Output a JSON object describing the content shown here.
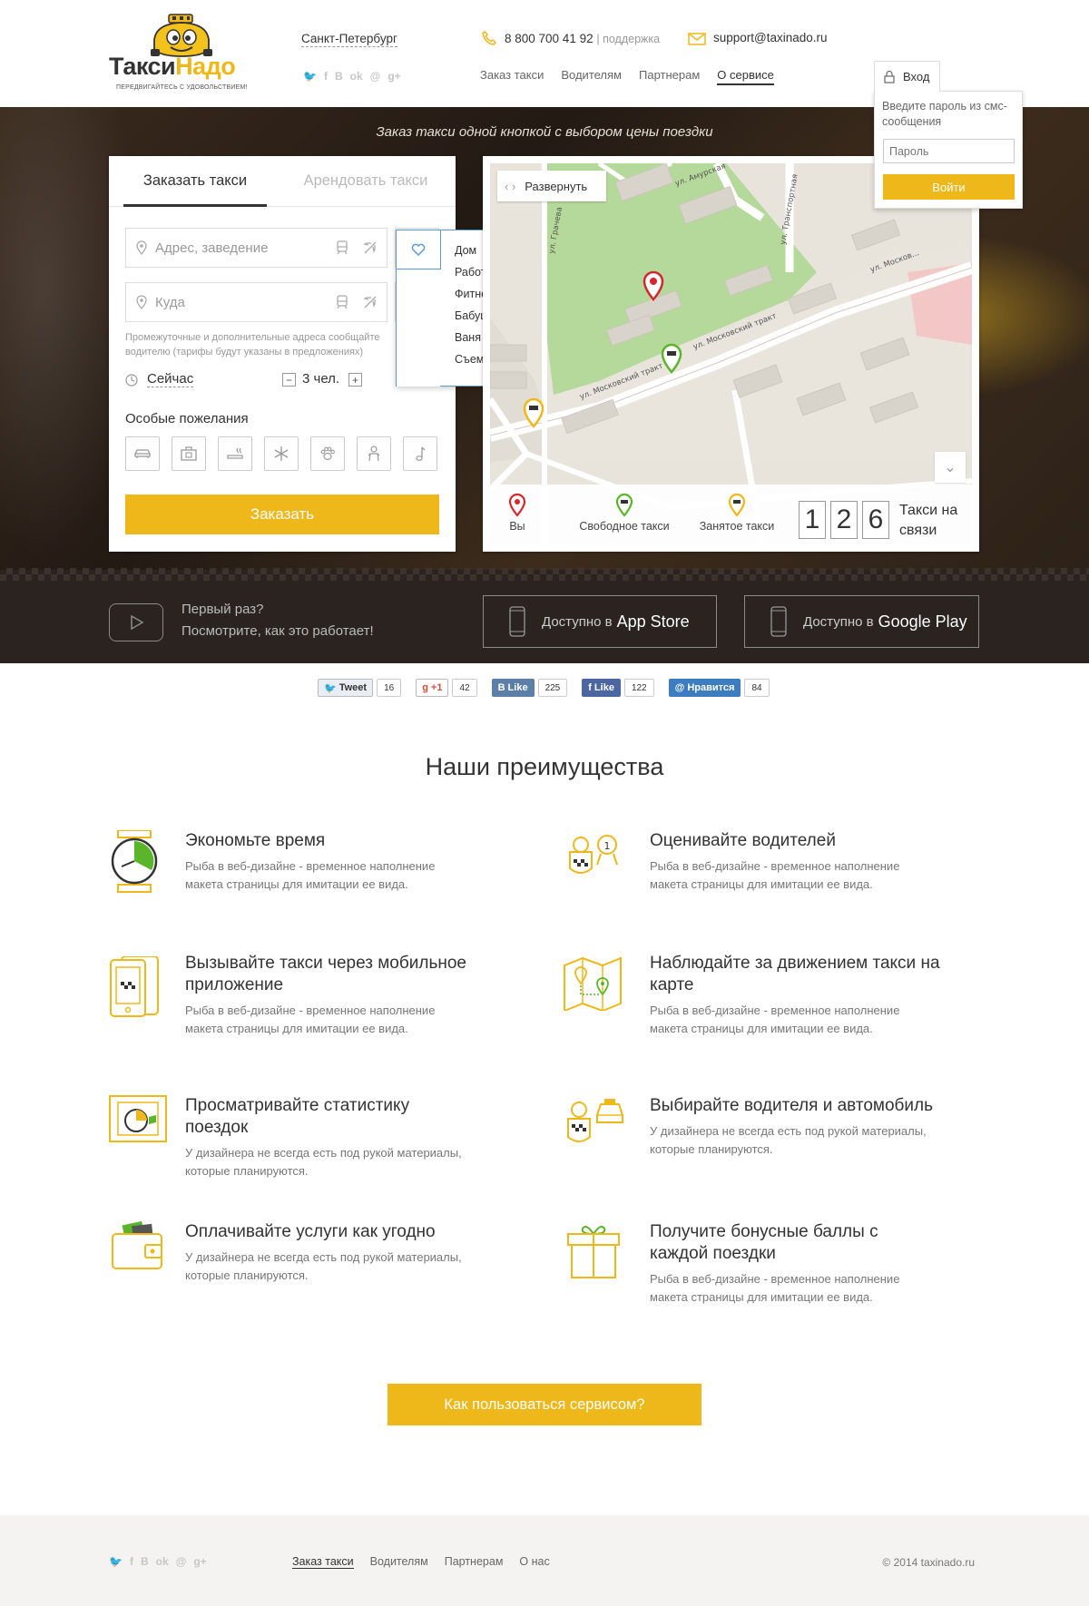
{
  "header": {
    "logo": {
      "part1": "Такси",
      "part2": "Надо",
      "tagline": "ПЕРЕДВИГАЙТЕСЬ С УДОВОЛЬСТВИЕМ!"
    },
    "city": "Санкт-Петербург",
    "phone": "8 800 700 41 92",
    "phone_note": "| поддержка",
    "email": "support@taxinado.ru",
    "social": [
      "twitter-icon",
      "facebook-icon",
      "vk-icon",
      "odnoklassniki-icon",
      "mailru-icon",
      "googleplus-icon"
    ],
    "nav": [
      {
        "label": "Заказ такси",
        "active": false
      },
      {
        "label": "Водителям",
        "active": false
      },
      {
        "label": "Партнерам",
        "active": false
      },
      {
        "label": "О сервисе",
        "active": true
      }
    ],
    "login": {
      "label": "Вход",
      "hint": "Введите пароль из смс-сообщения",
      "password_placeholder": "Пароль",
      "submit_label": "Войти"
    }
  },
  "hero": {
    "tagline": "Заказ такси одной кнопкой с выбором цены поездки",
    "order": {
      "tabs": [
        "Заказать такси",
        "Арендовать такси"
      ],
      "from_placeholder": "Адрес, заведение",
      "to_placeholder": "Куда",
      "note": "Промежуточные и дополнительные адреса сообщайте водителю (тарифы будут указаны в предложениях)",
      "time": "Сейчас",
      "passengers": "3 чел.",
      "wishes_title": "Особые пожелания",
      "wishes": [
        "car-icon",
        "baggage-icon",
        "smoking-icon",
        "snowflake-icon",
        "paw-icon",
        "child-icon",
        "music-icon"
      ],
      "submit_label": "Заказать"
    },
    "favorites": [
      "Дом",
      "Работа",
      "Фитнес-зал",
      "Бабушка",
      "Ваня",
      "Съемная квартира"
    ],
    "map": {
      "expand_label": "Развернуть",
      "streets": [
        "ул. Амурская",
        "ул. Московский тракт",
        "ул. Московский тракт",
        "ул. Грачева",
        "ул. Транспортная",
        "ул. Москов..."
      ],
      "legend": [
        {
          "label": "Вы",
          "color": "#d7262b"
        },
        {
          "label": "Свободное такси",
          "color": "#5ab52a"
        },
        {
          "label": "Занятое такси",
          "color": "#efb81a"
        }
      ],
      "counter": [
        "1",
        "2",
        "6"
      ],
      "counter_label": "Такси на связи"
    },
    "video": {
      "line1": "Первый раз?",
      "line2": "Посмотрите, как это работает!"
    },
    "stores": [
      {
        "prefix": "Доступно в",
        "name": "App Store"
      },
      {
        "prefix": "Доступно в",
        "name": "Google Play"
      }
    ]
  },
  "share": [
    {
      "label": "Tweet",
      "count": "16",
      "color": "#e8eef3",
      "text_color": "#333"
    },
    {
      "label": "+1",
      "count": "42",
      "color": "#fff",
      "text_color": "#dd4b39"
    },
    {
      "label": "Like",
      "count": "225",
      "color": "#5b7fa6",
      "text_color": "#fff"
    },
    {
      "label": "Like",
      "count": "122",
      "color": "#4c66a4",
      "text_color": "#fff"
    },
    {
      "label": "Нравится",
      "count": "84",
      "color": "#3b7dbf",
      "text_color": "#fff"
    }
  ],
  "advantages": {
    "title": "Наши преимущества",
    "items": [
      {
        "icon": "stopwatch-icon",
        "title": "Экономьте время",
        "desc": "Рыба в веб-дизайне - временное наполнение макета страницы для имитации ее вида."
      },
      {
        "icon": "driver-rating-icon",
        "title": "Оценивайте водителей",
        "desc": "Рыба в веб-дизайне - временное наполнение макета страницы для имитации ее вида."
      },
      {
        "icon": "mobile-app-icon",
        "title": "Вызывайте такси через мобильное приложение",
        "desc": "Рыба в веб-дизайне - временное наполнение макета страницы для имитации ее вида."
      },
      {
        "icon": "map-tracking-icon",
        "title": "Наблюдайте за движением такси на карте",
        "desc": "Рыба в веб-дизайне - временное наполнение макета страницы для имитации ее вида."
      },
      {
        "icon": "statistics-icon",
        "title": "Просматривайте статистику поездок",
        "desc": "У дизайнера не всегда есть под рукой материалы, которые планируются."
      },
      {
        "icon": "driver-car-icon",
        "title": "Выбирайте водителя и автомобиль",
        "desc": "У дизайнера не всегда есть под рукой материалы, которые планируются."
      },
      {
        "icon": "wallet-icon",
        "title": "Оплачивайте услуги как угодно",
        "desc": "У дизайнера не всегда есть под рукой материалы, которые планируются."
      },
      {
        "icon": "gift-icon",
        "title": "Получите бонусные баллы с каждой поездки",
        "desc": "Рыба в веб-дизайне - временное наполнение макета страницы для имитации ее вида."
      }
    ],
    "cta_label": "Как пользоваться сервисом?"
  },
  "footer": {
    "nav": [
      {
        "label": "Заказ такси",
        "active": true
      },
      {
        "label": "Водителям",
        "active": false
      },
      {
        "label": "Партнерам",
        "active": false
      },
      {
        "label": "О нас",
        "active": false
      }
    ],
    "copyright": "© 2014 taxinado.ru"
  },
  "colors": {
    "accent": "#efb81a",
    "green": "#5ab52a",
    "red": "#d7262b",
    "dark": "#2b221c"
  }
}
